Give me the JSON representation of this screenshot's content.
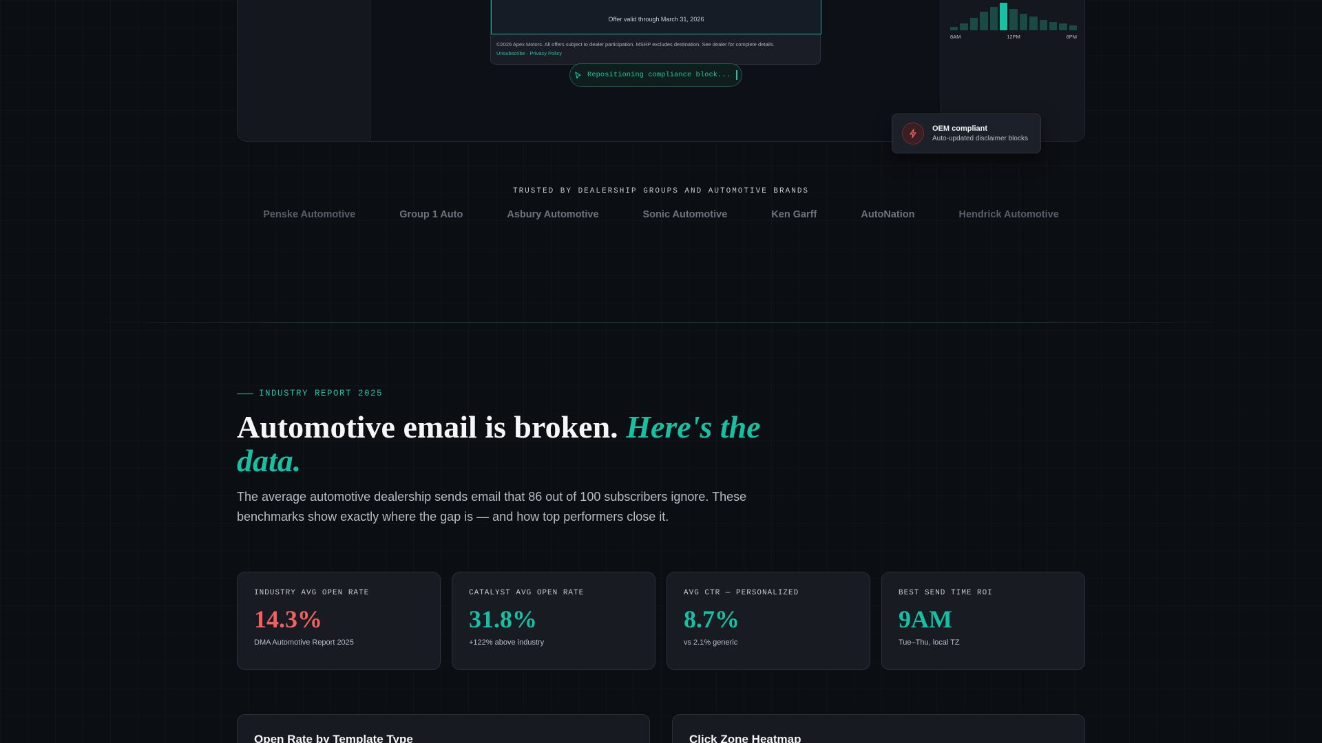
{
  "mockup": {
    "offer_text": "Offer valid through March 31, 2026",
    "legal_text": "©2026 Apex Motors. All offers subject to dealer participation. MSRP excludes destination. See dealer for complete details.",
    "legal_links": "Unsubscribe · Privacy Policy",
    "status_text": "Repositioning compliance block...",
    "mini_chart": {
      "bars": [
        0.12,
        0.22,
        0.42,
        0.62,
        0.78,
        0.92,
        0.7,
        0.55,
        0.46,
        0.34,
        0.28,
        0.22,
        0.15
      ],
      "highlight_index": 5,
      "axis_labels": [
        "8AM",
        "12PM",
        "6PM"
      ]
    },
    "toast": {
      "title": "OEM compliant",
      "subtitle": "Auto-updated disclaimer blocks",
      "icon": "bolt-icon"
    }
  },
  "trusted": {
    "heading": "TRUSTED BY DEALERSHIP GROUPS AND AUTOMOTIVE BRANDS",
    "brands": [
      "Penske Automotive",
      "Group 1 Auto",
      "Asbury Automotive",
      "Sonic Automotive",
      "Ken Garff",
      "AutoNation",
      "Hendrick Automotive"
    ]
  },
  "report": {
    "eyebrow": "INDUSTRY REPORT 2025",
    "headline_plain": "Automotive email is broken.",
    "headline_accent": "Here's the data.",
    "lede": "The average automotive dealership sends email that 86 out of 100 subscribers ignore. These benchmarks show exactly where the gap is — and how top performers close it."
  },
  "stats": [
    {
      "label": "INDUSTRY AVG OPEN RATE",
      "value": "14.3%",
      "note": "DMA Automotive Report 2025",
      "tone": "red"
    },
    {
      "label": "CATALYST AVG OPEN RATE",
      "value": "31.8%",
      "note": "+122% above industry",
      "tone": "teal"
    },
    {
      "label": "AVG CTR — PERSONALIZED",
      "value": "8.7%",
      "note": "vs 2.1% generic",
      "tone": "teal"
    },
    {
      "label": "BEST SEND TIME ROI",
      "value": "9AM",
      "note": "Tue–Thu, local TZ",
      "tone": "teal"
    }
  ],
  "panels": [
    {
      "title": "Open Rate by Template Type"
    },
    {
      "title": "Click Zone Heatmap"
    }
  ],
  "colors": {
    "accent": "#17c0a2",
    "danger": "#f0625f",
    "background": "#0b0e13"
  }
}
